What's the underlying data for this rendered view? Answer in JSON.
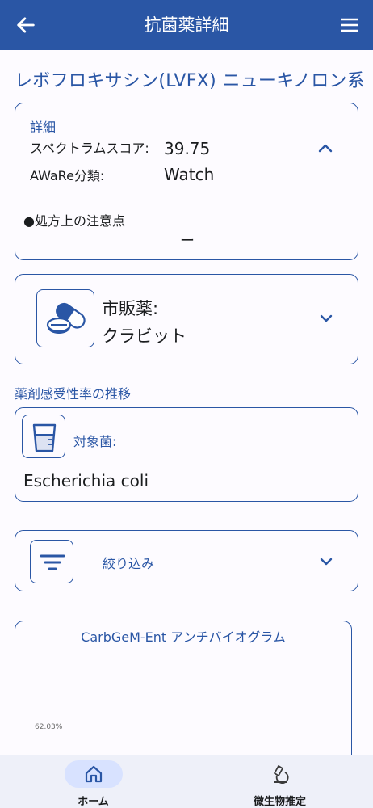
{
  "appbar": {
    "title": "抗菌薬詳細",
    "back_icon": "arrow-left-icon",
    "menu_icon": "hamburger-menu-icon",
    "color": "#2a56a5"
  },
  "drug": {
    "title": "レボフロキサシン(LVFX) ニューキノロン系"
  },
  "detail": {
    "header": "詳細",
    "spectrum_label": "スペクトラムスコア:",
    "spectrum_value": "39.75",
    "aware_label": "AWaRe分類:",
    "aware_value": "Watch",
    "note_label": "●処方上の注意点",
    "note_value": "ー",
    "toggle_icon": "chevron-up-icon"
  },
  "market": {
    "icon": "pills-icon",
    "label": "市販薬:",
    "value": "クラビット",
    "toggle_icon": "chevron-down-icon"
  },
  "susceptibility": {
    "section_label": "薬剤感受性率の推移",
    "target_icon": "beaker-icon",
    "target_label": "対象菌:",
    "target_value": "Escherichia coli"
  },
  "filter": {
    "icon": "filter-icon",
    "label": "絞り込み",
    "toggle_icon": "chevron-down-icon"
  },
  "chart": {
    "title": "CarbGeM-Ent アンチバイオグラム",
    "tick_label": "62.03%"
  },
  "bottom_nav": {
    "items": [
      {
        "label": "ホーム",
        "icon": "home-icon",
        "active": true
      },
      {
        "label": "微生物推定",
        "icon": "microscope-icon",
        "active": false
      }
    ],
    "active_pill_color": "#d8e2ff"
  }
}
